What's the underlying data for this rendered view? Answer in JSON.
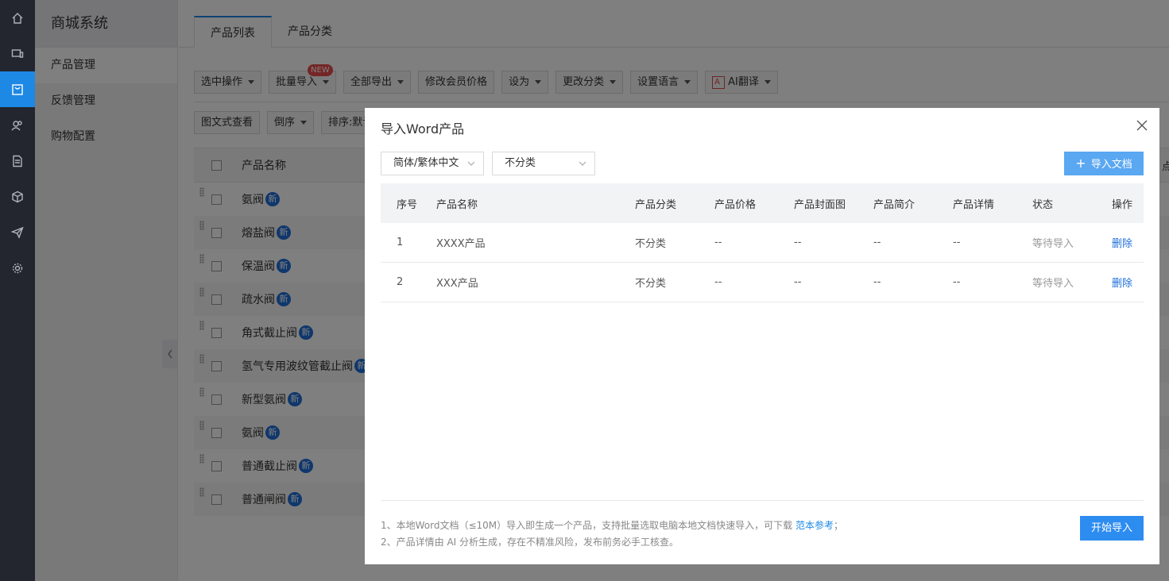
{
  "rail": {
    "items": [
      {
        "icon": "home-icon"
      },
      {
        "icon": "monitor-icon"
      },
      {
        "icon": "store-icon",
        "active": true
      },
      {
        "icon": "users-icon"
      },
      {
        "icon": "document-icon"
      },
      {
        "icon": "box-icon"
      },
      {
        "icon": "send-icon"
      },
      {
        "icon": "gear-icon"
      }
    ]
  },
  "subnav": {
    "title": "商城系统",
    "items": [
      {
        "label": "产品管理",
        "active": true
      },
      {
        "label": "反馈管理"
      },
      {
        "label": "购物配置"
      }
    ]
  },
  "tabs": [
    {
      "label": "产品列表",
      "active": true
    },
    {
      "label": "产品分类"
    }
  ],
  "toolbar": {
    "select_op": "选中操作",
    "batch_import": "批量导入",
    "new_badge": "NEW",
    "export_all": "全部导出",
    "edit_member_price": "修改会员价格",
    "set_as": "设为",
    "change_category": "更改分类",
    "set_language": "设置语言",
    "ai_translate": "AI翻译"
  },
  "toolbar2": {
    "view_mode": "图文式查看",
    "order": "倒序",
    "sort": "排序:默认"
  },
  "product_table": {
    "name_header": "产品名称",
    "new_label": "新",
    "rows": [
      {
        "name": "氨阀"
      },
      {
        "name": "熔盐阀"
      },
      {
        "name": "保温阀"
      },
      {
        "name": "疏水阀"
      },
      {
        "name": "角式截止阀"
      },
      {
        "name": "氢气专用波纹管截止阀"
      },
      {
        "name": "新型氨阀"
      },
      {
        "name": "氨阀"
      },
      {
        "name": "普通截止阀"
      },
      {
        "name": "普通闸阀"
      }
    ],
    "edge_text": "点"
  },
  "modal": {
    "title": "导入Word产品",
    "lang_select": "简体/繁体中文",
    "category_select": "不分类",
    "import_doc_button": "导入文档",
    "headers": [
      "序号",
      "产品名称",
      "产品分类",
      "产品价格",
      "产品封面图",
      "产品简介",
      "产品详情",
      "状态",
      "操作"
    ],
    "rows": [
      {
        "index": "1",
        "name": "XXXX产品",
        "category": "不分类",
        "price": "--",
        "cover": "--",
        "intro": "--",
        "detail": "--",
        "status": "等待导入",
        "action": "删除"
      },
      {
        "index": "2",
        "name": "XXX产品",
        "category": "不分类",
        "price": "--",
        "cover": "--",
        "intro": "--",
        "detail": "--",
        "status": "等待导入",
        "action": "删除"
      }
    ],
    "note1_prefix": "1、本地Word文档（≤10M）导入即生成一个产品，支持批量选取电脑本地文档快速导入，可下载 ",
    "note1_link": "范本参考",
    "note1_suffix": "；",
    "note2": "2、产品详情由 AI 分析生成，存在不精准风险，发布前务必手工核查。",
    "start_button": "开始导入"
  },
  "colors": {
    "accent": "#1e88e5",
    "rail_bg": "#23262e",
    "new_badge": "#e94b4b",
    "new_pill": "#1e6fd9"
  }
}
